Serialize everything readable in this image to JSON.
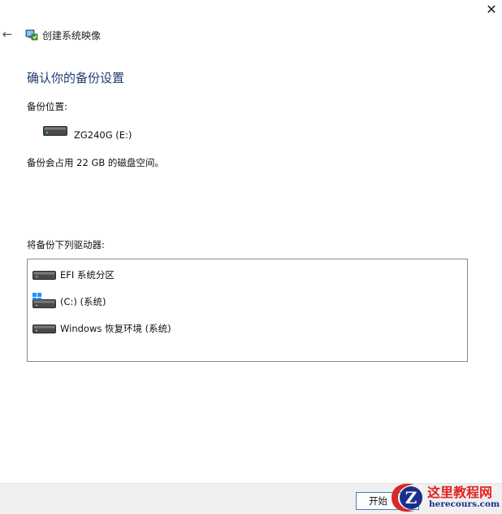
{
  "window": {
    "title": "创建系统映像",
    "close_glyph": "✕",
    "back_glyph": "←"
  },
  "heading": "确认你的备份设置",
  "backup_location": {
    "label": "备份位置:",
    "destination": "ZG240G (E:)"
  },
  "space_text": "备份会占用 22 GB 的磁盘空间。",
  "drives": {
    "label": "将备份下列驱动器:",
    "items": [
      {
        "label": "EFI 系统分区",
        "icon": "hard-drive-icon"
      },
      {
        "label": "(C:) (系统)",
        "icon": "windows-drive-icon"
      },
      {
        "label": "Windows 恢复环境 (系统)",
        "icon": "hard-drive-icon"
      }
    ]
  },
  "footer": {
    "start_label": "开始"
  },
  "watermark": {
    "title": "这里教程网",
    "url": "herecours.com"
  }
}
